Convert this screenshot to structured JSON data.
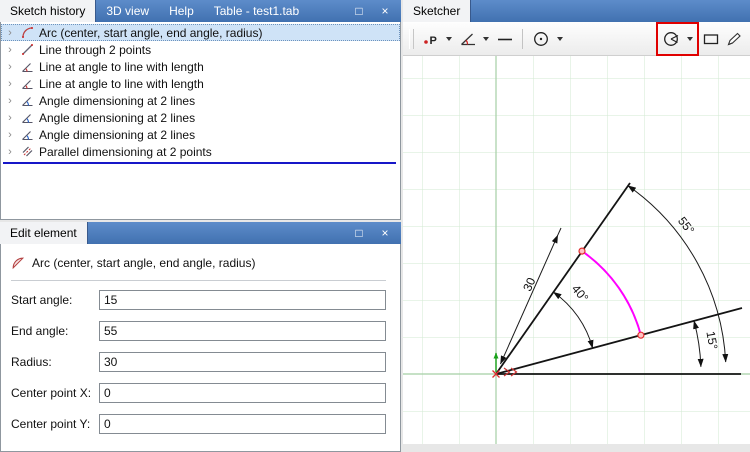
{
  "window_controls": {
    "maximize": "□",
    "close": "×"
  },
  "history_panel": {
    "tabs": {
      "sketch_history": "Sketch history",
      "view_3d": "3D view",
      "help": "Help",
      "table": "Table - test1.tab"
    },
    "expander_glyph": "›",
    "items": [
      "Arc (center, start angle, end angle, radius)",
      "Line through 2 points",
      "Line at angle to line with length",
      "Line at angle to line with length",
      "Angle dimensioning at 2 lines",
      "Angle dimensioning at 2 lines",
      "Angle dimensioning at 2 lines",
      "Parallel dimensioning at 2 points"
    ]
  },
  "edit_panel": {
    "title": "Edit element",
    "element_label": "Arc (center, start angle, end angle, radius)",
    "fields": {
      "start_angle": {
        "label": "Start angle:",
        "value": "15"
      },
      "end_angle": {
        "label": "End angle:",
        "value": "55"
      },
      "radius": {
        "label": "Radius:",
        "value": "30"
      },
      "center_x": {
        "label": "Center point X:",
        "value": "0"
      },
      "center_y": {
        "label": "Center point Y:",
        "value": "0"
      }
    }
  },
  "sketcher": {
    "tab_label": "Sketcher",
    "point_tool_label": "P",
    "dimensions": {
      "radius": "30",
      "included_angle": "40°",
      "end_angle": "55°",
      "start_angle": "15°"
    },
    "colors": {
      "selected_arc": "#ff00ff",
      "tool_highlight_box": "#e00000",
      "tab_bar_blue": "#4a7abf",
      "selection_row": "#cfe3f7",
      "insert_marker": "#1717c8",
      "grid_line": "#d2ead2",
      "axis_line": "#a5cfa5",
      "point_marker": "#e03030",
      "origin_axis_arrow": "#18a018"
    }
  }
}
